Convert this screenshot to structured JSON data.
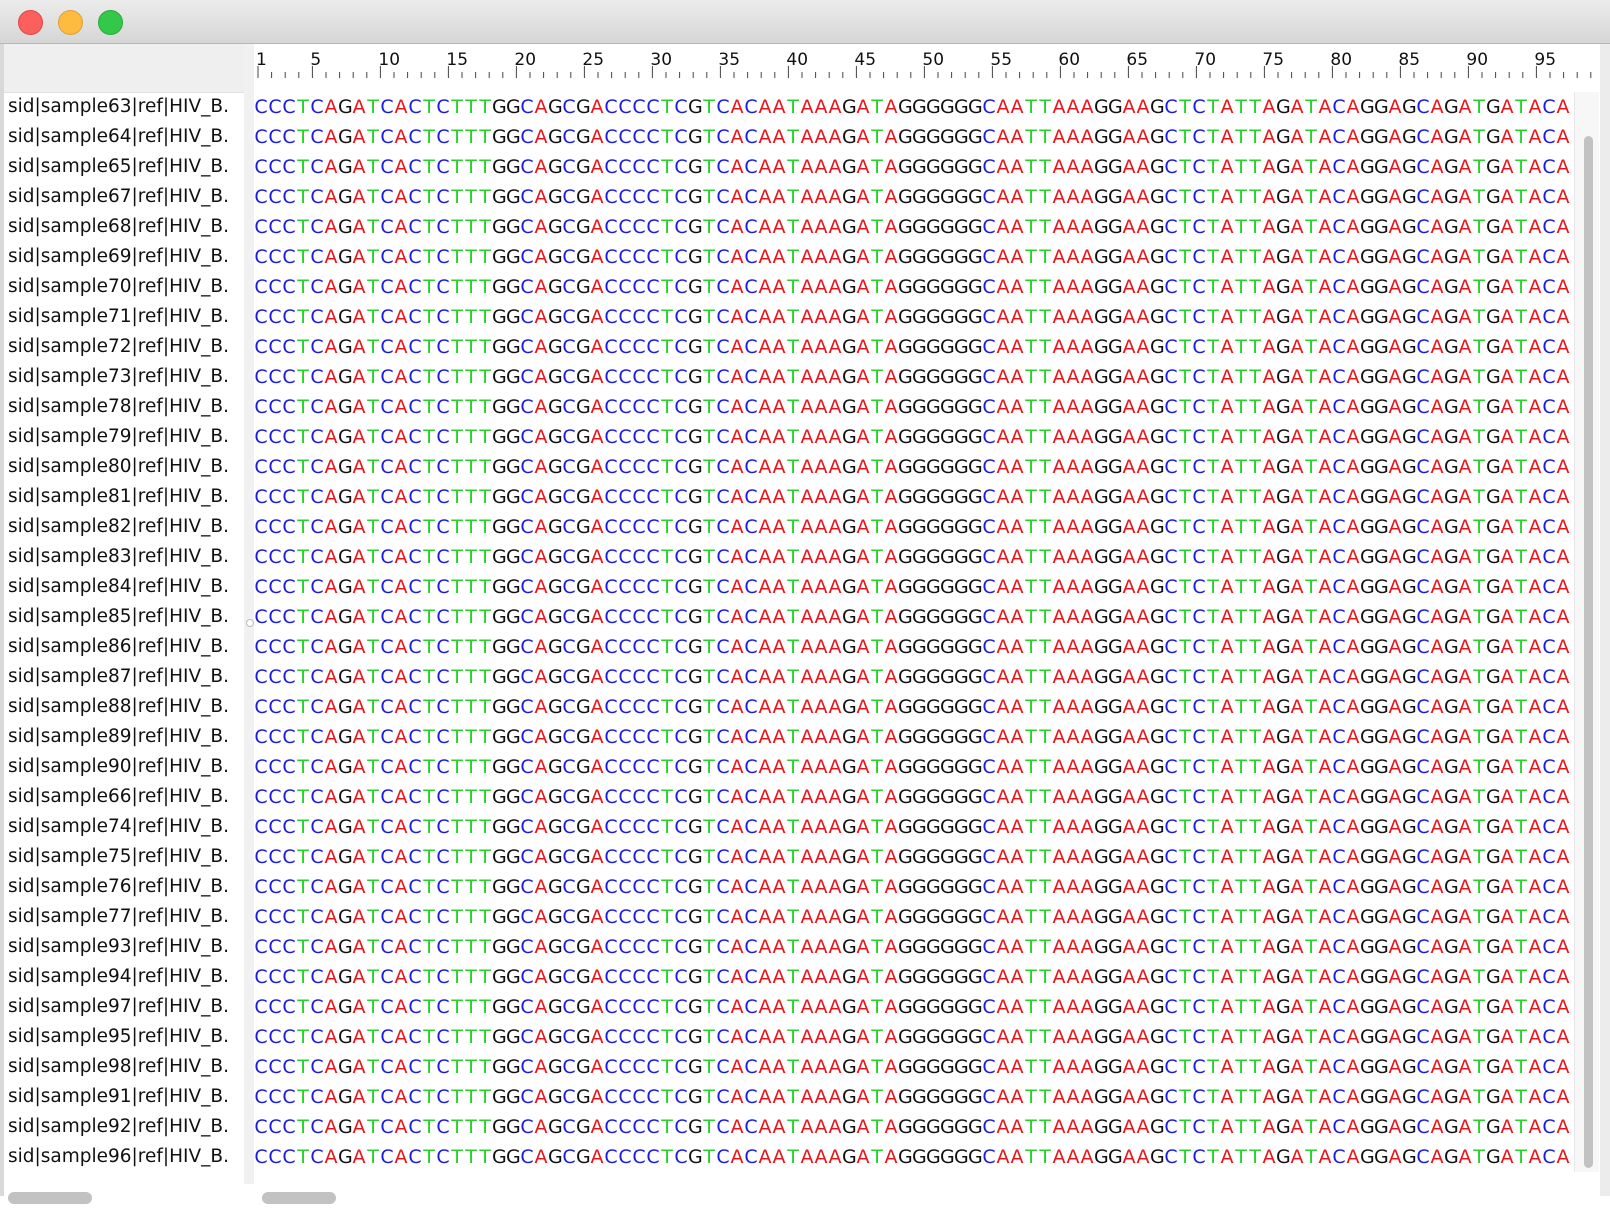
{
  "window": {
    "controls": {
      "close": "close-icon",
      "minimize": "minimize-icon",
      "maximize": "maximize-icon"
    },
    "colors": {
      "close": "#fc605c",
      "minimize": "#fdbc40",
      "maximize": "#34c84a"
    }
  },
  "ruler": {
    "labels": [
      "1",
      "5",
      "10",
      "15",
      "20",
      "25",
      "30",
      "35",
      "40",
      "45",
      "50",
      "55",
      "60",
      "65",
      "70",
      "75",
      "80",
      "85",
      "90",
      "95"
    ]
  },
  "sequence_colors": {
    "A": "#e8141a",
    "C": "#1a1ae0",
    "G": "#111111",
    "T": "#22d428"
  },
  "sequences": {
    "text": "CCCTCAGATCACTCTTTGGCAGCGACCCCTCGTCACAATAAAGATAGGGGGGCAATTAAAGGAAGCTCTATTAGATACAGGAGCAGATGATACA",
    "names": [
      "sid|sample63|ref|HIV_B.",
      "sid|sample64|ref|HIV_B.",
      "sid|sample65|ref|HIV_B.",
      "sid|sample67|ref|HIV_B.",
      "sid|sample68|ref|HIV_B.",
      "sid|sample69|ref|HIV_B.",
      "sid|sample70|ref|HIV_B.",
      "sid|sample71|ref|HIV_B.",
      "sid|sample72|ref|HIV_B.",
      "sid|sample73|ref|HIV_B.",
      "sid|sample78|ref|HIV_B.",
      "sid|sample79|ref|HIV_B.",
      "sid|sample80|ref|HIV_B.",
      "sid|sample81|ref|HIV_B.",
      "sid|sample82|ref|HIV_B.",
      "sid|sample83|ref|HIV_B.",
      "sid|sample84|ref|HIV_B.",
      "sid|sample85|ref|HIV_B.",
      "sid|sample86|ref|HIV_B.",
      "sid|sample87|ref|HIV_B.",
      "sid|sample88|ref|HIV_B.",
      "sid|sample89|ref|HIV_B.",
      "sid|sample90|ref|HIV_B.",
      "sid|sample66|ref|HIV_B.",
      "sid|sample74|ref|HIV_B.",
      "sid|sample75|ref|HIV_B.",
      "sid|sample76|ref|HIV_B.",
      "sid|sample77|ref|HIV_B.",
      "sid|sample93|ref|HIV_B.",
      "sid|sample94|ref|HIV_B.",
      "sid|sample97|ref|HIV_B.",
      "sid|sample95|ref|HIV_B.",
      "sid|sample98|ref|HIV_B.",
      "sid|sample91|ref|HIV_B.",
      "sid|sample92|ref|HIV_B.",
      "sid|sample96|ref|HIV_B."
    ]
  }
}
